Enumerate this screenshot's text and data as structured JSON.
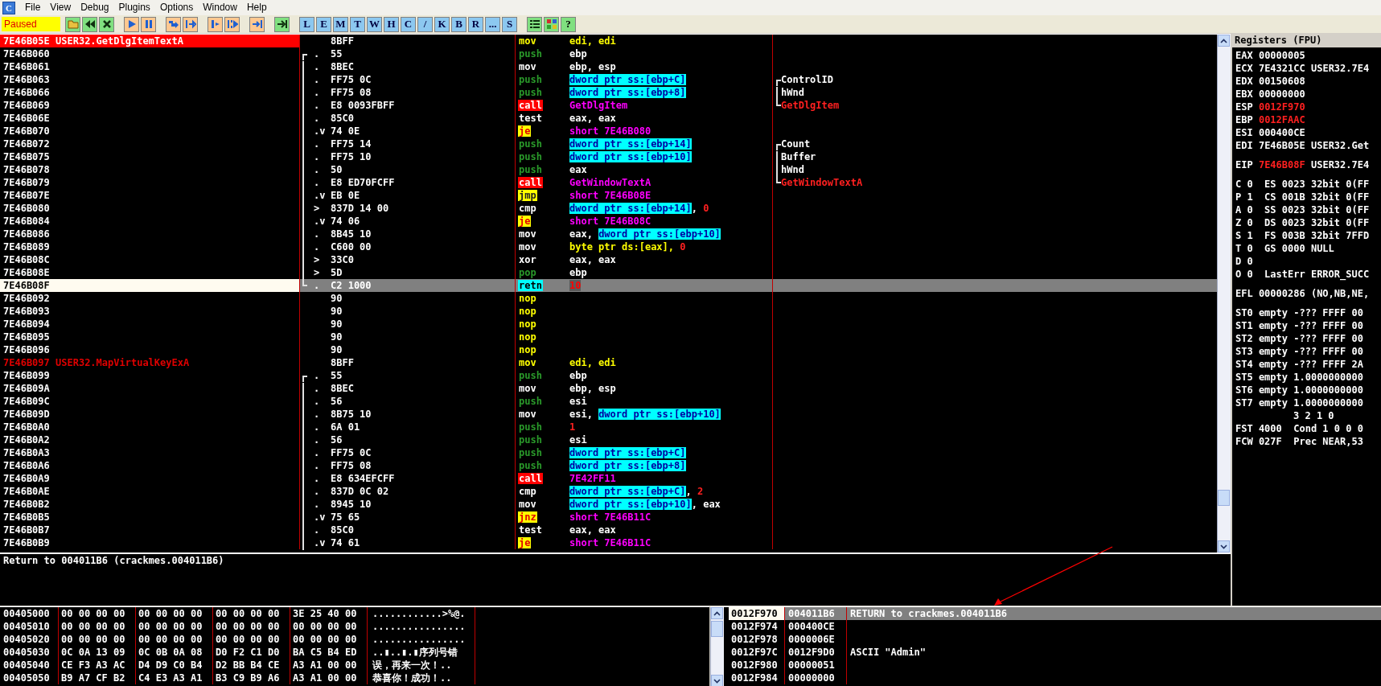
{
  "app_icon_letter": "C",
  "menu": [
    "File",
    "View",
    "Debug",
    "Plugins",
    "Options",
    "Window",
    "Help"
  ],
  "toolbar": {
    "status": "Paused",
    "letters": [
      "L",
      "E",
      "M",
      "T",
      "W",
      "H",
      "C",
      "/",
      "K",
      "B",
      "R",
      "...",
      "S"
    ],
    "help": "?"
  },
  "disasm": {
    "rows": [
      {
        "address": "7E46B05E",
        "label": "USER32.GetDlgItemTextA",
        "breakpoint": true,
        "selected": false,
        "hex": "8BFF",
        "mnemonic": {
          "text": "mov",
          "kind": "hot"
        },
        "operands": [
          {
            "text": "edi, edi",
            "kind": "hot"
          }
        ]
      },
      {
        "address": "7E46B060",
        "breakpoint": false,
        "selected": false,
        "bracket": {
          "kind": "start"
        },
        "jump_mark": ".",
        "hex": "55",
        "mnemonic": {
          "text": "push",
          "kind": "push"
        },
        "operands": [
          {
            "text": "ebp",
            "kind": "plain"
          }
        ]
      },
      {
        "address": "7E46B061",
        "breakpoint": false,
        "selected": false,
        "bracket": {
          "kind": "mid"
        },
        "jump_mark": ".",
        "hex": "8BEC",
        "mnemonic": {
          "text": "mov",
          "kind": "plain"
        },
        "operands": [
          {
            "text": "ebp, esp",
            "kind": "plain"
          }
        ]
      },
      {
        "address": "7E46B063",
        "breakpoint": false,
        "selected": false,
        "bracket": {
          "kind": "mid"
        },
        "jump_mark": ".",
        "hex": "FF75 0C",
        "mnemonic": {
          "text": "push",
          "kind": "push"
        },
        "operands": [
          {
            "text": "dword ptr ss:[ebp+C]",
            "kind": "mem"
          }
        ],
        "comment": {
          "text": "ControlID",
          "bracket": {
            "kind": "start"
          },
          "kind": "plain"
        }
      },
      {
        "address": "7E46B066",
        "breakpoint": false,
        "selected": false,
        "bracket": {
          "kind": "mid"
        },
        "jump_mark": ".",
        "hex": "FF75 08",
        "mnemonic": {
          "text": "push",
          "kind": "push"
        },
        "operands": [
          {
            "text": "dword ptr ss:[ebp+8]",
            "kind": "mem"
          }
        ],
        "comment": {
          "text": "hWnd",
          "bracket": {
            "kind": "mid"
          },
          "kind": "plain"
        }
      },
      {
        "address": "7E46B069",
        "breakpoint": false,
        "selected": false,
        "bracket": {
          "kind": "mid"
        },
        "jump_mark": ".",
        "hex": "E8 0093FBFF",
        "mnemonic": {
          "text": "call",
          "kind": "call"
        },
        "operands": [
          {
            "text": "GetDlgItem",
            "kind": "target"
          }
        ],
        "comment": {
          "text": "GetDlgItem",
          "bracket": {
            "kind": "end"
          },
          "kind": "api"
        }
      },
      {
        "address": "7E46B06E",
        "breakpoint": false,
        "selected": false,
        "bracket": {
          "kind": "mid"
        },
        "jump_mark": ".",
        "hex": "85C0",
        "mnemonic": {
          "text": "test",
          "kind": "plain"
        },
        "operands": [
          {
            "text": "eax, eax",
            "kind": "plain"
          }
        ]
      },
      {
        "address": "7E46B070",
        "breakpoint": false,
        "selected": false,
        "bracket": {
          "kind": "mid"
        },
        "jump_mark": ".v",
        "hex": "74 0E",
        "mnemonic": {
          "text": "je",
          "kind": "jump"
        },
        "operands": [
          {
            "text": "short 7E46B080",
            "kind": "target"
          }
        ]
      },
      {
        "address": "7E46B072",
        "breakpoint": false,
        "selected": false,
        "bracket": {
          "kind": "mid"
        },
        "jump_mark": ".",
        "hex": "FF75 14",
        "mnemonic": {
          "text": "push",
          "kind": "push"
        },
        "operands": [
          {
            "text": "dword ptr ss:[ebp+14]",
            "kind": "mem"
          }
        ],
        "comment": {
          "text": "Count",
          "bracket": {
            "kind": "start"
          },
          "kind": "plain"
        }
      },
      {
        "address": "7E46B075",
        "breakpoint": false,
        "selected": false,
        "bracket": {
          "kind": "mid"
        },
        "jump_mark": ".",
        "hex": "FF75 10",
        "mnemonic": {
          "text": "push",
          "kind": "push"
        },
        "operands": [
          {
            "text": "dword ptr ss:[ebp+10]",
            "kind": "mem"
          }
        ],
        "comment": {
          "text": "Buffer",
          "bracket": {
            "kind": "mid"
          },
          "kind": "plain"
        }
      },
      {
        "address": "7E46B078",
        "breakpoint": false,
        "selected": false,
        "bracket": {
          "kind": "mid"
        },
        "jump_mark": ".",
        "hex": "50",
        "mnemonic": {
          "text": "push",
          "kind": "push"
        },
        "operands": [
          {
            "text": "eax",
            "kind": "plain"
          }
        ],
        "comment": {
          "text": "hWnd",
          "bracket": {
            "kind": "mid"
          },
          "kind": "plain"
        }
      },
      {
        "address": "7E46B079",
        "breakpoint": false,
        "selected": false,
        "bracket": {
          "kind": "mid"
        },
        "jump_mark": ".",
        "hex": "E8 ED70FCFF",
        "mnemonic": {
          "text": "call",
          "kind": "call"
        },
        "operands": [
          {
            "text": "GetWindowTextA",
            "kind": "target"
          }
        ],
        "comment": {
          "text": "GetWindowTextA",
          "bracket": {
            "kind": "end"
          },
          "kind": "api"
        }
      },
      {
        "address": "7E46B07E",
        "breakpoint": false,
        "selected": false,
        "bracket": {
          "kind": "mid"
        },
        "jump_mark": ".v",
        "hex": "EB 0E",
        "mnemonic": {
          "text": "jmp",
          "kind": "jmp"
        },
        "operands": [
          {
            "text": "short 7E46B08E",
            "kind": "target"
          }
        ]
      },
      {
        "address": "7E46B080",
        "breakpoint": false,
        "selected": false,
        "bracket": {
          "kind": "mid"
        },
        "jump_mark": ">",
        "hex": "837D 14 00",
        "mnemonic": {
          "text": "cmp",
          "kind": "plain"
        },
        "operands": [
          {
            "text": "dword ptr ss:[ebp+14]",
            "kind": "mem"
          },
          {
            "text": ", ",
            "kind": "plain"
          },
          {
            "text": "0",
            "kind": "const"
          }
        ]
      },
      {
        "address": "7E46B084",
        "breakpoint": false,
        "selected": false,
        "bracket": {
          "kind": "mid"
        },
        "jump_mark": ".v",
        "hex": "74 06",
        "mnemonic": {
          "text": "je",
          "kind": "jump"
        },
        "operands": [
          {
            "text": "short 7E46B08C",
            "kind": "target"
          }
        ]
      },
      {
        "address": "7E46B086",
        "breakpoint": false,
        "selected": false,
        "bracket": {
          "kind": "mid"
        },
        "jump_mark": ".",
        "hex": "8B45 10",
        "mnemonic": {
          "text": "mov",
          "kind": "plain"
        },
        "operands": [
          {
            "text": "eax, ",
            "kind": "plain"
          },
          {
            "text": "dword ptr ss:[ebp+10]",
            "kind": "mem"
          }
        ]
      },
      {
        "address": "7E46B089",
        "breakpoint": false,
        "selected": false,
        "bracket": {
          "kind": "mid"
        },
        "jump_mark": ".",
        "hex": "C600 00",
        "mnemonic": {
          "text": "mov",
          "kind": "plain"
        },
        "operands": [
          {
            "text": "byte ptr ds:[eax], ",
            "kind": "hot"
          },
          {
            "text": "0",
            "kind": "const"
          }
        ]
      },
      {
        "address": "7E46B08C",
        "breakpoint": false,
        "selected": false,
        "bracket": {
          "kind": "mid"
        },
        "jump_mark": ">",
        "hex": "33C0",
        "mnemonic": {
          "text": "xor",
          "kind": "plain"
        },
        "operands": [
          {
            "text": "eax, eax",
            "kind": "plain"
          }
        ]
      },
      {
        "address": "7E46B08E",
        "breakpoint": false,
        "selected": false,
        "bracket": {
          "kind": "mid"
        },
        "jump_mark": ">",
        "hex": "5D",
        "mnemonic": {
          "text": "pop",
          "kind": "push"
        },
        "operands": [
          {
            "text": "ebp",
            "kind": "plain"
          }
        ]
      },
      {
        "address": "7E46B08F",
        "breakpoint": false,
        "selected": true,
        "bracket": {
          "kind": "end"
        },
        "jump_mark": ".",
        "hex": "C2 1000",
        "mnemonic": {
          "text": "retn",
          "kind": "ret"
        },
        "operands": [
          {
            "text": "10",
            "kind": "const"
          }
        ]
      },
      {
        "address": "7E46B092",
        "breakpoint": false,
        "selected": false,
        "hex": "90",
        "mnemonic": {
          "text": "nop",
          "kind": "hot"
        },
        "operands": []
      },
      {
        "address": "7E46B093",
        "breakpoint": false,
        "selected": false,
        "hex": "90",
        "mnemonic": {
          "text": "nop",
          "kind": "hot"
        },
        "operands": []
      },
      {
        "address": "7E46B094",
        "breakpoint": false,
        "selected": false,
        "hex": "90",
        "mnemonic": {
          "text": "nop",
          "kind": "hot"
        },
        "operands": []
      },
      {
        "address": "7E46B095",
        "breakpoint": false,
        "selected": false,
        "hex": "90",
        "mnemonic": {
          "text": "nop",
          "kind": "hot"
        },
        "operands": []
      },
      {
        "address": "7E46B096",
        "breakpoint": false,
        "selected": false,
        "hex": "90",
        "mnemonic": {
          "text": "nop",
          "kind": "hot"
        },
        "operands": []
      },
      {
        "address": "7E46B097",
        "label": "USER32.MapVirtualKeyExA",
        "breakpoint": false,
        "selected": false,
        "hex": "8BFF",
        "mnemonic": {
          "text": "mov",
          "kind": "hot"
        },
        "operands": [
          {
            "text": "edi, edi",
            "kind": "hot"
          }
        ]
      },
      {
        "address": "7E46B099",
        "breakpoint": false,
        "selected": false,
        "bracket": {
          "kind": "start"
        },
        "jump_mark": ".",
        "hex": "55",
        "mnemonic": {
          "text": "push",
          "kind": "push"
        },
        "operands": [
          {
            "text": "ebp",
            "kind": "plain"
          }
        ]
      },
      {
        "address": "7E46B09A",
        "breakpoint": false,
        "selected": false,
        "bracket": {
          "kind": "mid"
        },
        "jump_mark": ".",
        "hex": "8BEC",
        "mnemonic": {
          "text": "mov",
          "kind": "plain"
        },
        "operands": [
          {
            "text": "ebp, esp",
            "kind": "plain"
          }
        ]
      },
      {
        "address": "7E46B09C",
        "breakpoint": false,
        "selected": false,
        "bracket": {
          "kind": "mid"
        },
        "jump_mark": ".",
        "hex": "56",
        "mnemonic": {
          "text": "push",
          "kind": "push"
        },
        "operands": [
          {
            "text": "esi",
            "kind": "plain"
          }
        ]
      },
      {
        "address": "7E46B09D",
        "breakpoint": false,
        "selected": false,
        "bracket": {
          "kind": "mid"
        },
        "jump_mark": ".",
        "hex": "8B75 10",
        "mnemonic": {
          "text": "mov",
          "kind": "plain"
        },
        "operands": [
          {
            "text": "esi, ",
            "kind": "plain"
          },
          {
            "text": "dword ptr ss:[ebp+10]",
            "kind": "mem"
          }
        ]
      },
      {
        "address": "7E46B0A0",
        "breakpoint": false,
        "selected": false,
        "bracket": {
          "kind": "mid"
        },
        "jump_mark": ".",
        "hex": "6A 01",
        "mnemonic": {
          "text": "push",
          "kind": "push"
        },
        "operands": [
          {
            "text": "1",
            "kind": "const"
          }
        ]
      },
      {
        "address": "7E46B0A2",
        "breakpoint": false,
        "selected": false,
        "bracket": {
          "kind": "mid"
        },
        "jump_mark": ".",
        "hex": "56",
        "mnemonic": {
          "text": "push",
          "kind": "push"
        },
        "operands": [
          {
            "text": "esi",
            "kind": "plain"
          }
        ]
      },
      {
        "address": "7E46B0A3",
        "breakpoint": false,
        "selected": false,
        "bracket": {
          "kind": "mid"
        },
        "jump_mark": ".",
        "hex": "FF75 0C",
        "mnemonic": {
          "text": "push",
          "kind": "push"
        },
        "operands": [
          {
            "text": "dword ptr ss:[ebp+C]",
            "kind": "mem"
          }
        ]
      },
      {
        "address": "7E46B0A6",
        "breakpoint": false,
        "selected": false,
        "bracket": {
          "kind": "mid"
        },
        "jump_mark": ".",
        "hex": "FF75 08",
        "mnemonic": {
          "text": "push",
          "kind": "push"
        },
        "operands": [
          {
            "text": "dword ptr ss:[ebp+8]",
            "kind": "mem"
          }
        ]
      },
      {
        "address": "7E46B0A9",
        "breakpoint": false,
        "selected": false,
        "bracket": {
          "kind": "mid"
        },
        "jump_mark": ".",
        "hex": "E8 634EFCFF",
        "mnemonic": {
          "text": "call",
          "kind": "call"
        },
        "operands": [
          {
            "text": "7E42FF11",
            "kind": "target"
          }
        ]
      },
      {
        "address": "7E46B0AE",
        "breakpoint": false,
        "selected": false,
        "bracket": {
          "kind": "mid"
        },
        "jump_mark": ".",
        "hex": "837D 0C 02",
        "mnemonic": {
          "text": "cmp",
          "kind": "plain"
        },
        "operands": [
          {
            "text": "dword ptr ss:[ebp+C]",
            "kind": "mem"
          },
          {
            "text": ", ",
            "kind": "plain"
          },
          {
            "text": "2",
            "kind": "const"
          }
        ]
      },
      {
        "address": "7E46B0B2",
        "breakpoint": false,
        "selected": false,
        "bracket": {
          "kind": "mid"
        },
        "jump_mark": ".",
        "hex": "8945 10",
        "mnemonic": {
          "text": "mov",
          "kind": "plain"
        },
        "operands": [
          {
            "text": "dword ptr ss:[ebp+10]",
            "kind": "mem"
          },
          {
            "text": ", eax",
            "kind": "plain"
          }
        ]
      },
      {
        "address": "7E46B0B5",
        "breakpoint": false,
        "selected": false,
        "bracket": {
          "kind": "mid"
        },
        "jump_mark": ".v",
        "hex": "75 65",
        "mnemonic": {
          "text": "jnz",
          "kind": "jump"
        },
        "operands": [
          {
            "text": "short 7E46B11C",
            "kind": "target"
          }
        ]
      },
      {
        "address": "7E46B0B7",
        "breakpoint": false,
        "selected": false,
        "bracket": {
          "kind": "mid"
        },
        "jump_mark": ".",
        "hex": "85C0",
        "mnemonic": {
          "text": "test",
          "kind": "plain"
        },
        "operands": [
          {
            "text": "eax, eax",
            "kind": "plain"
          }
        ]
      },
      {
        "address": "7E46B0B9",
        "breakpoint": false,
        "selected": false,
        "bracket": {
          "kind": "mid"
        },
        "jump_mark": ".v",
        "hex": "74 61",
        "mnemonic": {
          "text": "je",
          "kind": "jump"
        },
        "operands": [
          {
            "text": "short 7E46B11C",
            "kind": "target"
          }
        ]
      }
    ]
  },
  "info": "Return to 004011B6 (crackmes.004011B6)",
  "registers": {
    "title": "Registers (FPU)",
    "groups": [
      {
        "lines": [
          {
            "kind": "reg",
            "name": "EAX",
            "value": "00000005",
            "changed": false
          },
          {
            "kind": "reg",
            "name": "ECX",
            "value": "7E4321CC",
            "changed": false,
            "note": "USER32.7E4"
          },
          {
            "kind": "reg",
            "name": "EDX",
            "value": "00150608",
            "changed": false
          },
          {
            "kind": "reg",
            "name": "EBX",
            "value": "00000000",
            "changed": false
          },
          {
            "kind": "reg",
            "name": "ESP",
            "value": "0012F970",
            "changed": true
          },
          {
            "kind": "reg",
            "name": "EBP",
            "value": "0012FAAC",
            "changed": true
          },
          {
            "kind": "reg",
            "name": "ESI",
            "value": "000400CE",
            "changed": false
          },
          {
            "kind": "reg",
            "name": "EDI",
            "value": "7E46B05E",
            "changed": false,
            "note": "USER32.Get"
          }
        ]
      },
      {
        "lines": [
          {
            "kind": "reg",
            "name": "EIP",
            "value": "7E46B08F",
            "changed": true,
            "note": "USER32.7E4"
          }
        ]
      },
      {
        "lines": [
          {
            "kind": "text",
            "text": "C 0  ES 0023 32bit 0(FF"
          },
          {
            "kind": "text",
            "text": "P 1  CS 001B 32bit 0(FF"
          },
          {
            "kind": "text",
            "text": "A 0  SS 0023 32bit 0(FF"
          },
          {
            "kind": "text",
            "text": "Z 0  DS 0023 32bit 0(FF"
          },
          {
            "kind": "text",
            "text": "S 1  FS 003B 32bit 7FFD"
          },
          {
            "kind": "text",
            "text": "T 0  GS 0000 NULL"
          },
          {
            "kind": "text",
            "text": "D 0"
          },
          {
            "kind": "text",
            "text": "O 0  LastErr ERROR_SUCC"
          }
        ]
      },
      {
        "lines": [
          {
            "kind": "text",
            "text": "EFL 00000286 (NO,NB,NE,"
          }
        ]
      },
      {
        "lines": [
          {
            "kind": "text",
            "text": "ST0 empty -??? FFFF 00"
          },
          {
            "kind": "text",
            "text": "ST1 empty -??? FFFF 00"
          },
          {
            "kind": "text",
            "text": "ST2 empty -??? FFFF 00"
          },
          {
            "kind": "text",
            "text": "ST3 empty -??? FFFF 00"
          },
          {
            "kind": "text",
            "text": "ST4 empty -??? FFFF 2A"
          },
          {
            "kind": "text",
            "text": "ST5 empty 1.0000000000"
          },
          {
            "kind": "text",
            "text": "ST6 empty 1.0000000000"
          },
          {
            "kind": "text",
            "text": "ST7 empty 1.0000000000"
          },
          {
            "kind": "indent",
            "text": "3 2 1 0"
          },
          {
            "kind": "text",
            "text": "FST 4000  Cond 1 0 0 0"
          },
          {
            "kind": "text",
            "text": "FCW 027F  Prec NEAR,53"
          }
        ]
      }
    ]
  },
  "dump": {
    "rows": [
      {
        "address": "00405000",
        "bytes": [
          "00 00 00 00",
          "00 00 00 00",
          "00 00 00 00",
          "3E 25 40 00"
        ],
        "ascii": "............>%@."
      },
      {
        "address": "00405010",
        "bytes": [
          "00 00 00 00",
          "00 00 00 00",
          "00 00 00 00",
          "00 00 00 00"
        ],
        "ascii": "................"
      },
      {
        "address": "00405020",
        "bytes": [
          "00 00 00 00",
          "00 00 00 00",
          "00 00 00 00",
          "00 00 00 00"
        ],
        "ascii": "................"
      },
      {
        "address": "00405030",
        "bytes": [
          "0C 0A 13 09",
          "0C 0B 0A 08",
          "D0 F2 C1 D0",
          "BA C5 B4 ED"
        ],
        "ascii": "..▮..▮.▮序列号错"
      },
      {
        "address": "00405040",
        "bytes": [
          "CE F3 A3 AC",
          "D4 D9 C0 B4",
          "D2 BB B4 CE",
          "A3 A1 00 00"
        ],
        "ascii": "误，再来一次！.."
      },
      {
        "address": "00405050",
        "bytes": [
          "B9 A7 CF B2",
          "C4 E3 A3 A1",
          "B3 C9 B9 A6",
          "A3 A1 00 00"
        ],
        "ascii": "恭喜你！成功！.."
      }
    ]
  },
  "stack": {
    "rows": [
      {
        "address": "0012F970",
        "value": "004011B6",
        "comment": "RETURN to crackmes.004011B6",
        "selected": true
      },
      {
        "address": "0012F974",
        "value": "000400CE",
        "selected": false
      },
      {
        "address": "0012F978",
        "value": "0000006E",
        "selected": false
      },
      {
        "address": "0012F97C",
        "value": "0012F9D0",
        "comment": "ASCII \"Admin\"",
        "selected": false
      },
      {
        "address": "0012F980",
        "value": "00000051",
        "selected": false
      },
      {
        "address": "0012F984",
        "value": "00000000",
        "selected": false
      }
    ]
  }
}
